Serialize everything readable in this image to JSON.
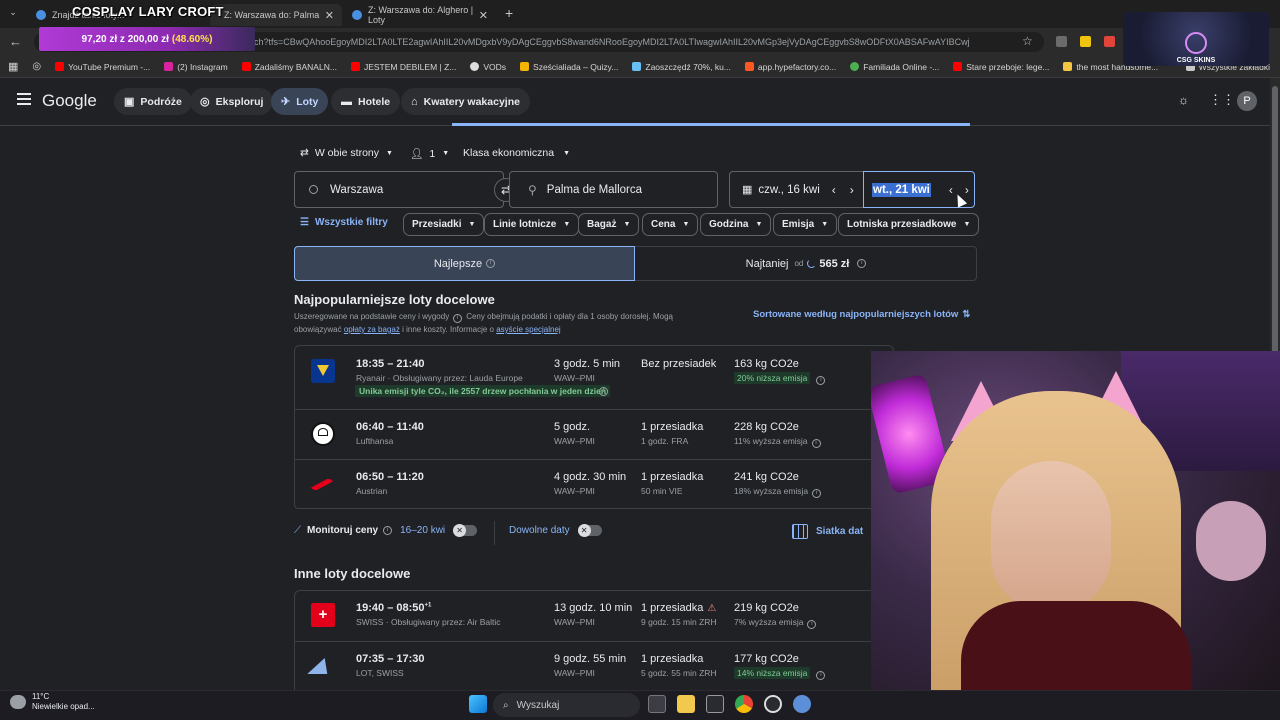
{
  "browser": {
    "tabs": [
      {
        "title": "Znajdź tanie loty...",
        "active": false
      },
      {
        "title": "Z: Warszawa do: Palma de Mall...",
        "active": true
      },
      {
        "title": "Z: Warszawa do: Alghero | Loty",
        "active": false
      }
    ],
    "url": "ch?tfs=CBwQAhooEgoyMDI2LTA0LTE2agwIAhIIL20vMDgxbV9yDAgCEggvbS8wand6NRooEgoyMDI2LTA0LTIwagwIAhIIL20vMGp3ejVyDAgCEggvbS8wODFtX0ABSAFwAYIBCwj",
    "bookmarks": [
      "YouTube Premium -...",
      "(2) Instagram",
      "Zadaliśmy BANALN...",
      "JESTEM DEBILEM | Z...",
      "VODs",
      "Sześcialiada – Quizy...",
      "Zaoszczędź 70%, ku...",
      "app.hypefactory.co...",
      "Familiada Online -...",
      "Stare przeboje: lege...",
      "the most handsome...",
      "Wszystkie zakładki"
    ]
  },
  "overlay": {
    "title": "COSPLAY LARY CROFT",
    "progress_current": "97,20 zł",
    "progress_sep": "z",
    "progress_goal": "200,00 zł",
    "progress_pct": "(48.60%)",
    "progress_fraction": 0.486,
    "brand": "CSG SKINS"
  },
  "header": {
    "logo": "Google",
    "nav": [
      {
        "label": "Podróże",
        "icon": "suitcase-icon"
      },
      {
        "label": "Eksploruj",
        "icon": "explore-icon"
      },
      {
        "label": "Loty",
        "icon": "plane-icon",
        "active": true
      },
      {
        "label": "Hotele",
        "icon": "bed-icon"
      },
      {
        "label": "Kwatery wakacyjne",
        "icon": "house-icon"
      }
    ],
    "avatar": "P"
  },
  "search": {
    "trip_type": "W obie strony",
    "passengers": "1",
    "cabin": "Klasa ekonomiczna",
    "from": "Warszawa",
    "to": "Palma de Mallorca",
    "depart": "czw., 16 kwi",
    "return": "wt., 21 kwi"
  },
  "filters": [
    "Wszystkie filtry",
    "Przesiadki",
    "Linie lotnicze",
    "Bagaż",
    "Cena",
    "Godzina",
    "Emisja",
    "Lotniska przesiadkowe"
  ],
  "sort": {
    "best": "Najlepsze",
    "cheapest": "Najtaniej",
    "cheapest_prefix": "od",
    "cheapest_price": "565 zł"
  },
  "results": {
    "title": "Najpopularniejsze loty docelowe",
    "desc1": "Uszeregowane na podstawie ceny i wygody",
    "desc2": "Ceny obejmują podatki i opłaty dla 1 osoby dorosłej. Mogą",
    "desc3": "obowiązywać",
    "link1": "opłaty za bagaż",
    "desc4": "i inne koszty. Informacje o",
    "link2": "asyście specjalnej",
    "sorted_label": "Sortowane według najpopularniejszych lotów",
    "flights": [
      {
        "time": "18:35 – 21:40",
        "airline": "Ryanair · Obsługiwany przez: Lauda Europe",
        "duration": "3 godz. 5 min",
        "route": "WAW–PMI",
        "stops": "Bez przesiadek",
        "stop_detail": "",
        "co2": "163 kg CO2e",
        "emission": "20% niższa emisja",
        "green": true,
        "note": "Unika emisji tyle CO₂, ile 2557 drzew pochłania w jeden dzień"
      },
      {
        "time": "06:40 – 11:40",
        "airline": "Lufthansa",
        "duration": "5 godz.",
        "route": "WAW–PMI",
        "stops": "1 przesiadka",
        "stop_detail": "1 godz. FRA",
        "co2": "228 kg CO2e",
        "emission": "11% wyższa emisja",
        "green": false
      },
      {
        "time": "06:50 – 11:20",
        "airline": "Austrian",
        "duration": "4 godz. 30 min",
        "route": "WAW–PMI",
        "stops": "1 przesiadka",
        "stop_detail": "50 min VIE",
        "co2": "241 kg CO2e",
        "emission": "18% wyższa emisja",
        "green": false
      }
    ],
    "track_label": "Monitoruj ceny",
    "track_dates": "16–20 kwi",
    "any_dates": "Dowolne daty",
    "date_grid": "Siatka dat",
    "other_title": "Inne loty docelowe",
    "other_flights": [
      {
        "time": "19:40 – 08:50",
        "plus": "+1",
        "airline": "SWISS · Obsługiwany przez: Air Baltic",
        "duration": "13 godz. 10 min",
        "route": "WAW–PMI",
        "stops": "1 przesiadka",
        "stop_detail": "9 godz. 15 min ZRH",
        "co2": "219 kg CO2e",
        "emission": "7% wyższa emisja",
        "green": false
      },
      {
        "time": "07:35 – 17:30",
        "plus": "",
        "airline": "LOT, SWISS",
        "duration": "9 godz. 55 min",
        "route": "WAW–PMI",
        "stops": "1 przesiadka",
        "stop_detail": "5 godz. 55 min ZRH",
        "co2": "177 kg CO2e",
        "emission": "14% niższa emisja",
        "green": true
      }
    ]
  },
  "taskbar": {
    "weather_temp": "11°C",
    "weather_desc": "Niewielkie opad...",
    "search": "Wyszukaj"
  }
}
